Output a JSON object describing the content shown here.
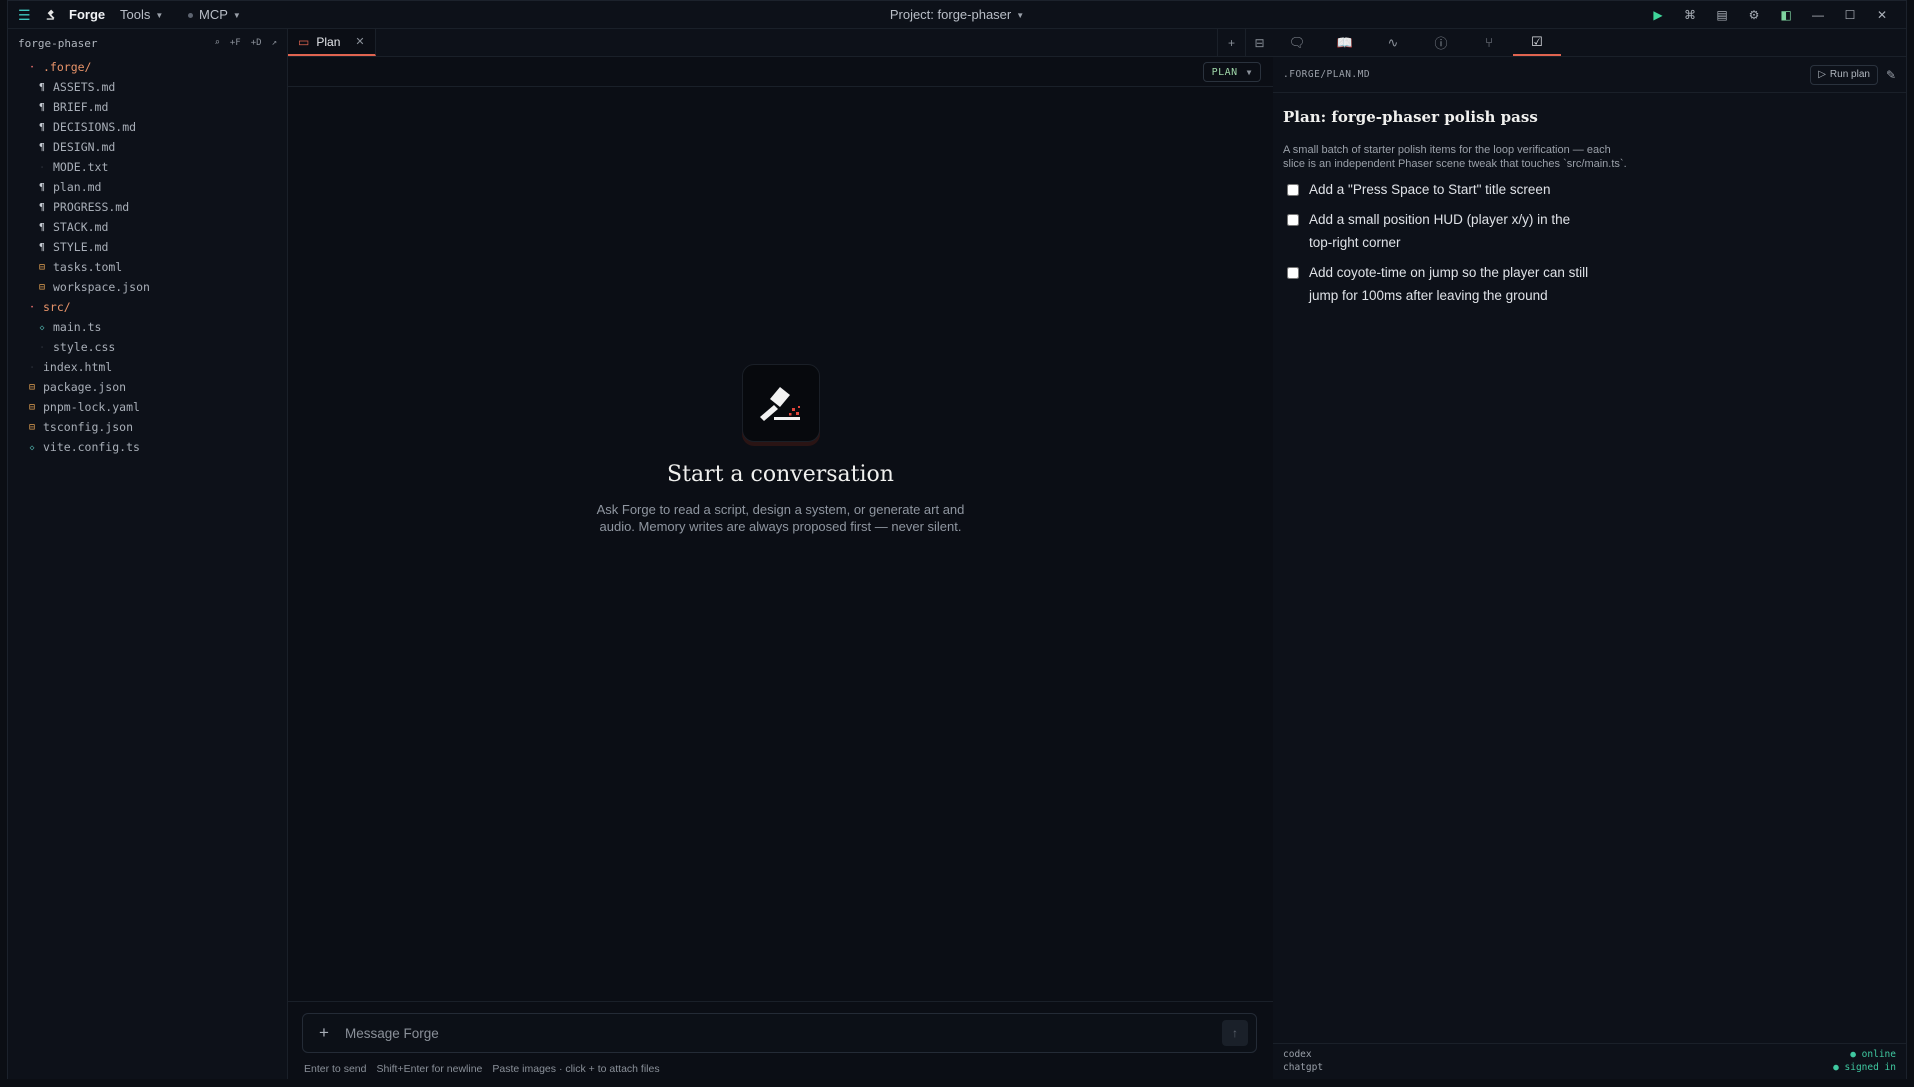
{
  "app": {
    "name": "Forge",
    "menus": {
      "tools": "Tools",
      "mcp": "MCP"
    },
    "project_title": "Project: forge-phaser"
  },
  "sidebar": {
    "title": "forge-phaser",
    "actions": [
      "⌕",
      "+F",
      "+D",
      "↗"
    ],
    "tree": [
      {
        "label": ".forge/",
        "type": "folder",
        "depth": 0
      },
      {
        "label": "ASSETS.md",
        "type": "md",
        "depth": 1
      },
      {
        "label": "BRIEF.md",
        "type": "md",
        "depth": 1
      },
      {
        "label": "DECISIONS.md",
        "type": "md",
        "depth": 1
      },
      {
        "label": "DESIGN.md",
        "type": "md",
        "depth": 1
      },
      {
        "label": "MODE.txt",
        "type": "txt",
        "depth": 1
      },
      {
        "label": "plan.md",
        "type": "md",
        "depth": 1
      },
      {
        "label": "PROGRESS.md",
        "type": "md",
        "depth": 1
      },
      {
        "label": "STACK.md",
        "type": "md",
        "depth": 1
      },
      {
        "label": "STYLE.md",
        "type": "md",
        "depth": 1
      },
      {
        "label": "tasks.toml",
        "type": "toml",
        "depth": 1
      },
      {
        "label": "workspace.json",
        "type": "toml",
        "depth": 1
      },
      {
        "label": "src/",
        "type": "folder",
        "depth": 0
      },
      {
        "label": "main.ts",
        "type": "ts",
        "depth": 1
      },
      {
        "label": "style.css",
        "type": "css",
        "depth": 1
      },
      {
        "label": "index.html",
        "type": "html",
        "depth": 0
      },
      {
        "label": "package.json",
        "type": "toml",
        "depth": 0
      },
      {
        "label": "pnpm-lock.yaml",
        "type": "toml",
        "depth": 0
      },
      {
        "label": "tsconfig.json",
        "type": "toml",
        "depth": 0
      },
      {
        "label": "vite.config.ts",
        "type": "ts",
        "depth": 0
      }
    ]
  },
  "center": {
    "tab_label": "Plan",
    "mode": "PLAN",
    "empty_title": "Start a conversation",
    "empty_desc": "Ask Forge to read a script, design a system, or generate art and audio. Memory writes are always proposed first — never silent.",
    "composer_placeholder": "Message Forge",
    "hints": [
      "Enter to send",
      "Shift+Enter for newline",
      "Paste images · click + to attach files"
    ]
  },
  "right": {
    "path": ".FORGE/PLAN.MD",
    "run_label": "Run plan",
    "plan_title": "Plan: forge-phaser polish pass",
    "plan_desc_1": "A small batch of starter polish items for the loop verification — each",
    "plan_desc_2": "slice is an independent Phaser scene tweak that touches `src/main.ts`.",
    "items": [
      "Add a \"Press Space to Start\" title screen",
      "Add a small position HUD (player x/y) in the top-right corner",
      "Add coyote-time on jump so the player can still jump for 100ms after leaving the ground"
    ],
    "footer": [
      {
        "name": "codex",
        "status": "● online"
      },
      {
        "name": "chatgpt",
        "status": "● signed in"
      }
    ]
  },
  "colors": {
    "accent": "#e06450",
    "ok": "#3fc8a0",
    "bg": "#0b0e14"
  }
}
